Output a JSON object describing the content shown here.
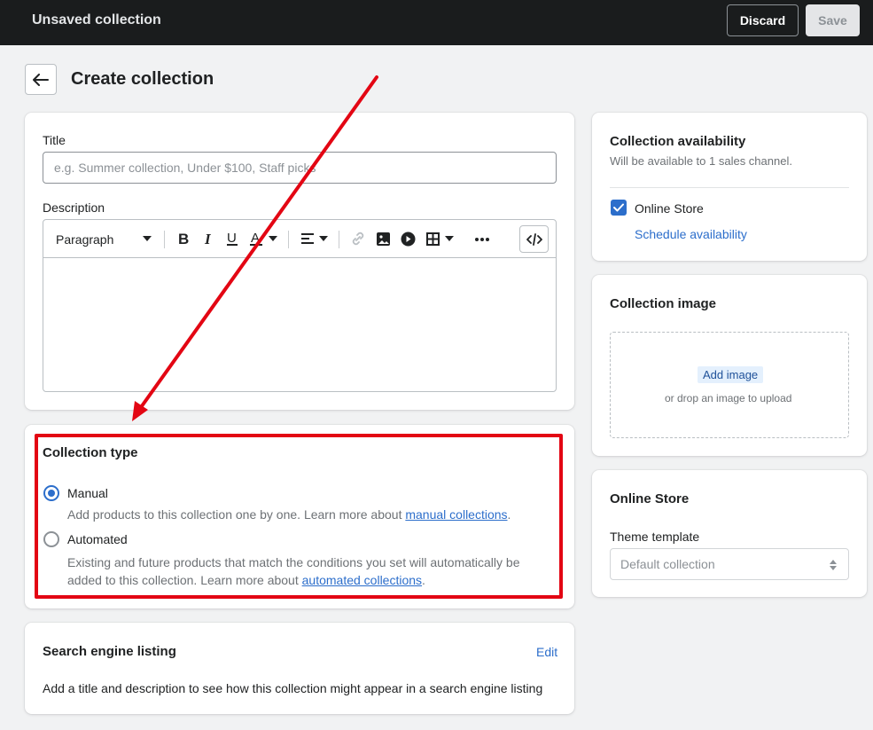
{
  "topbar": {
    "title": "Unsaved collection",
    "discard_label": "Discard",
    "save_label": "Save"
  },
  "page": {
    "title": "Create collection"
  },
  "form": {
    "title_label": "Title",
    "title_placeholder": "e.g. Summer collection, Under $100, Staff picks",
    "description_label": "Description",
    "paragraph_select": "Paragraph"
  },
  "collection_type": {
    "heading": "Collection type",
    "manual_label": "Manual",
    "manual_help": "Add products to this collection one by one. Learn more about ",
    "manual_link": "manual collections",
    "manual_end": ".",
    "automated_label": "Automated",
    "automated_help_line1": "Existing and future products that match the conditions you set will automatically be",
    "automated_help_line2": "added to this collection. Learn more about ",
    "automated_link": "automated collections",
    "automated_end": ".",
    "selected": "Manual"
  },
  "seo": {
    "heading": "Search engine listing",
    "edit_label": "Edit",
    "description": "Add a title and description to see how this collection might appear in a search engine listing"
  },
  "availability": {
    "heading": "Collection availability",
    "subtitle": "Will be available to 1 sales channel.",
    "channel_label": "Online Store",
    "channel_checked": true,
    "schedule_link": "Schedule availability"
  },
  "image": {
    "heading": "Collection image",
    "add_button": "Add image",
    "drop_hint": "or drop an image to upload"
  },
  "online_store": {
    "heading": "Online Store",
    "template_label": "Theme template",
    "template_value": "Default collection"
  },
  "colors": {
    "topbar": "#1a1c1d",
    "accent": "#2c6ecb",
    "annotation": "#e30613"
  }
}
